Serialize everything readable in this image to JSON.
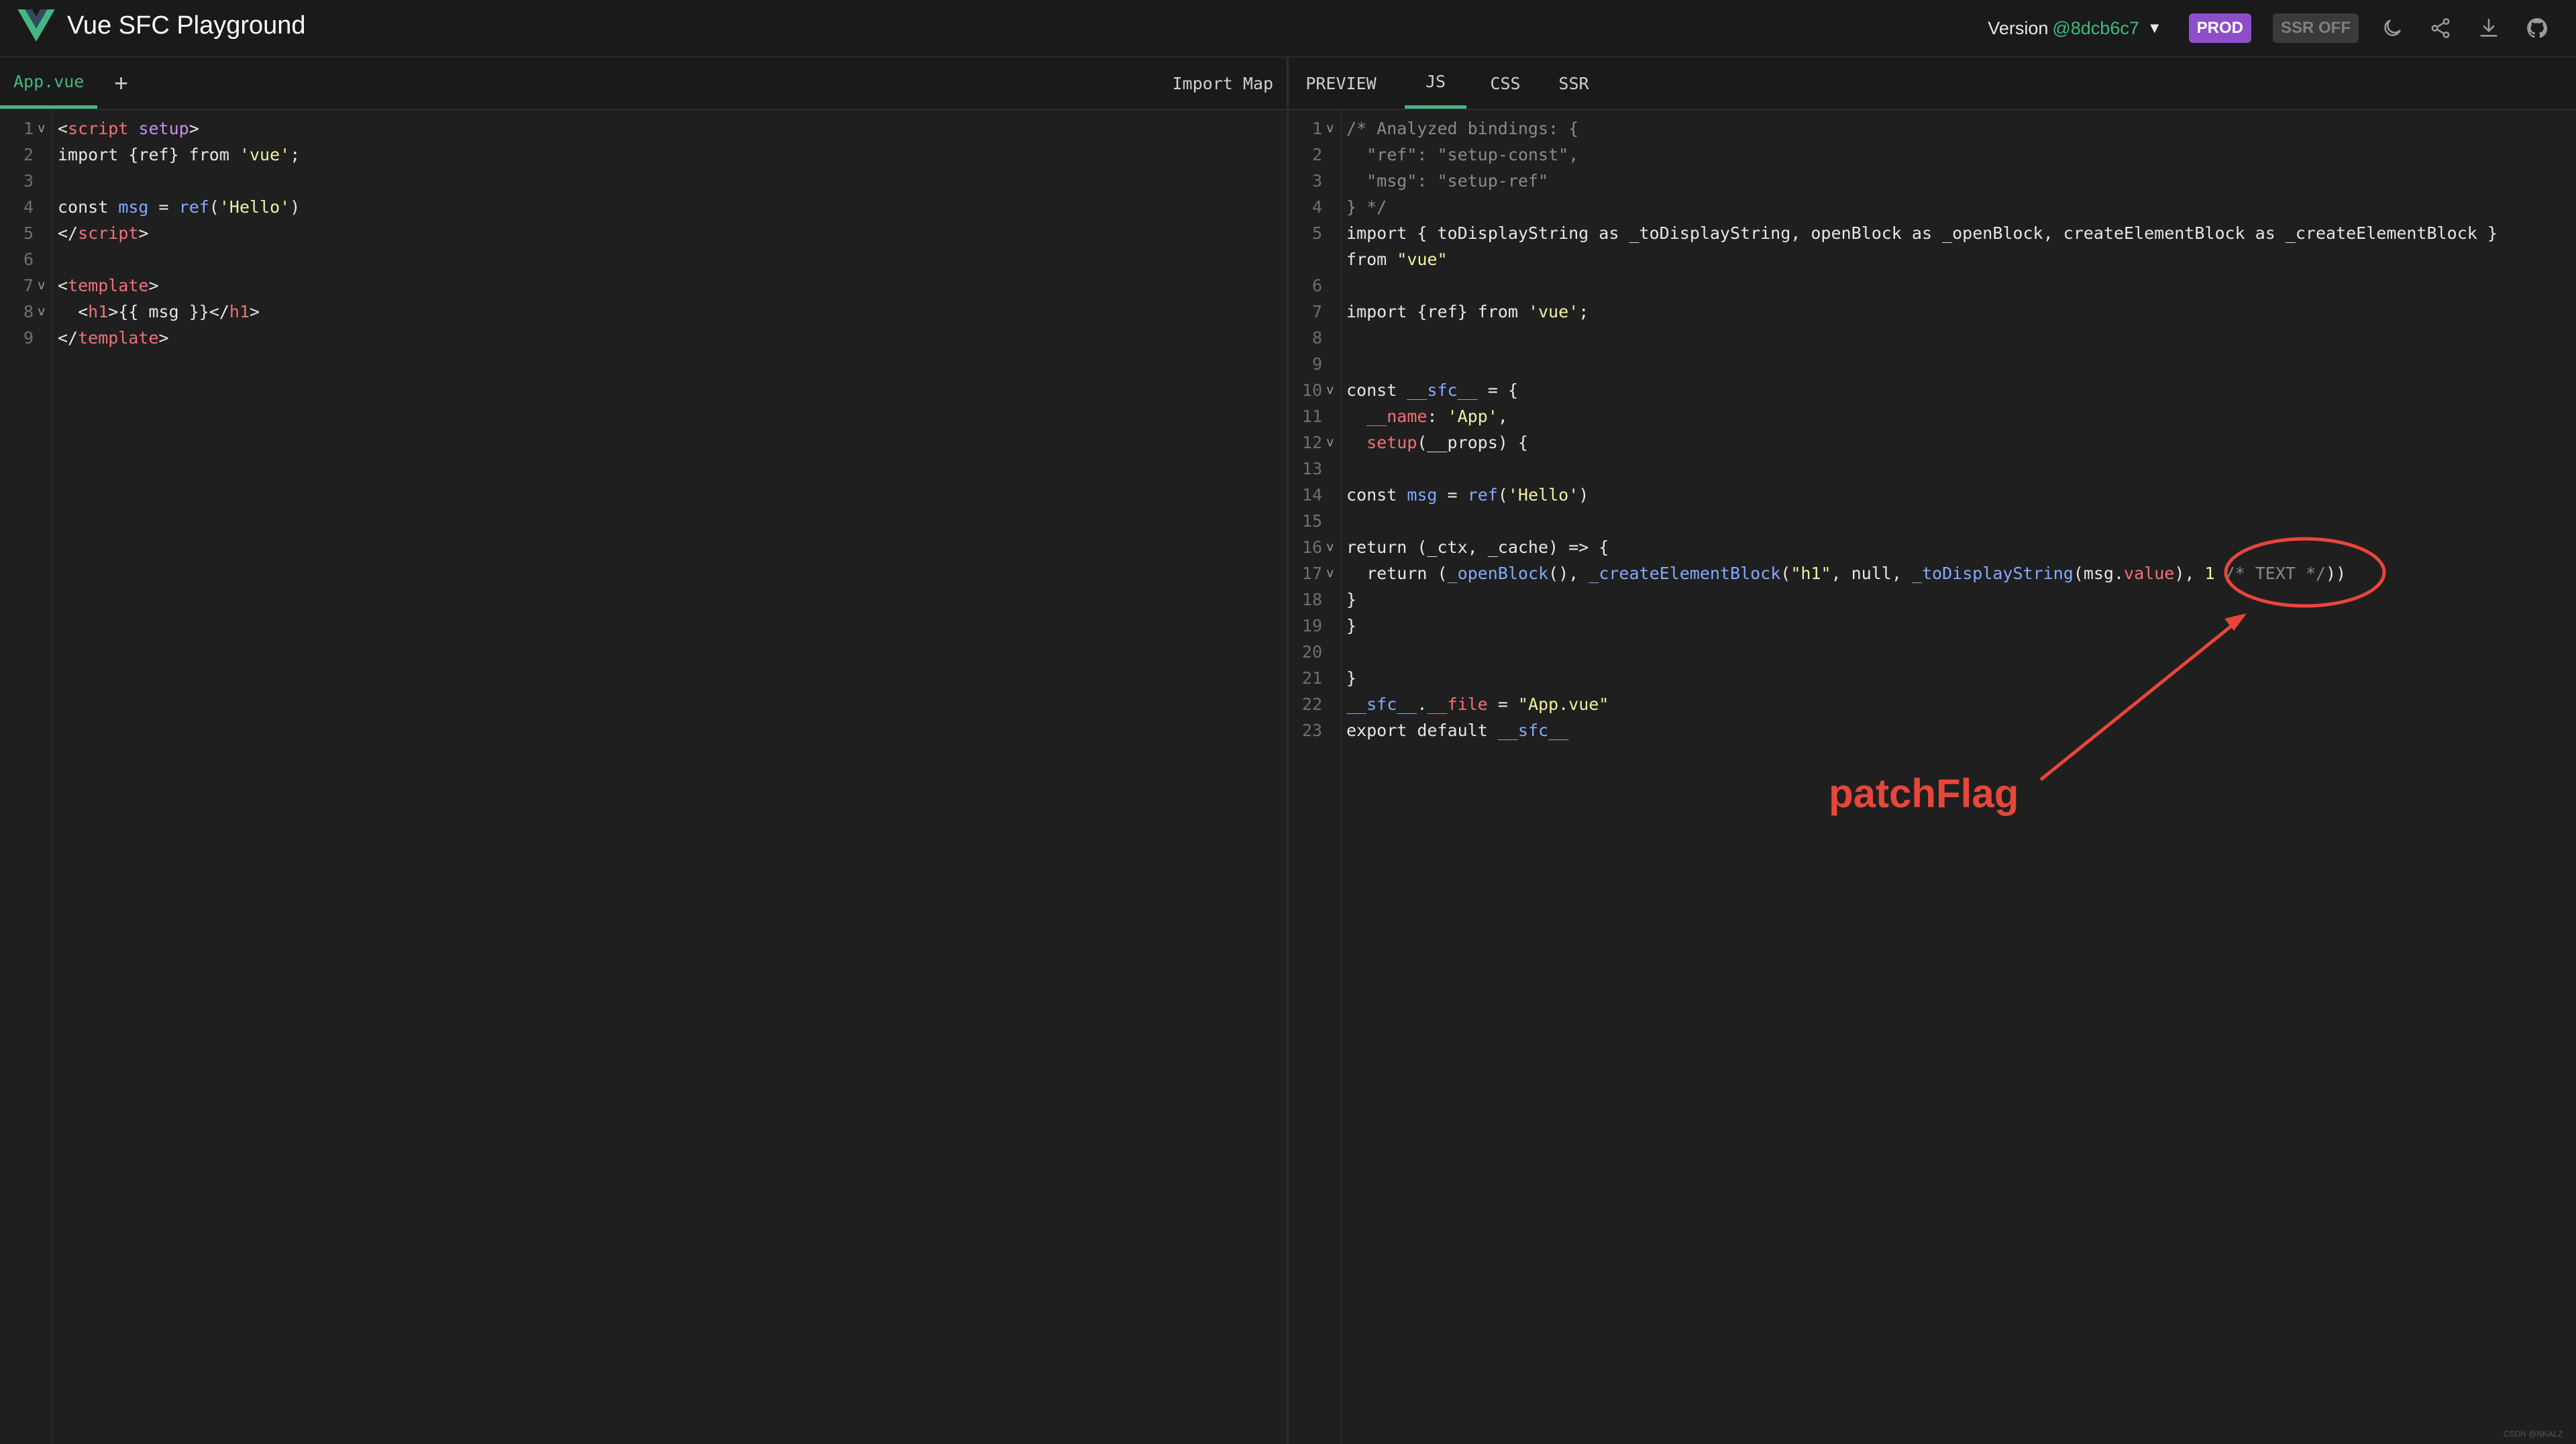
{
  "header": {
    "title": "Vue SFC Playground",
    "version_label": "Version",
    "version_value": "@8dcb6c7",
    "version_caret": "▼",
    "prod_badge": "PROD",
    "ssr_badge": "SSR OFF",
    "icons": [
      "moon-icon",
      "share-icon",
      "download-icon",
      "github-icon"
    ]
  },
  "left_panel": {
    "file_tab": "App.vue",
    "add_file": "+",
    "import_map": "Import Map",
    "lines": [
      {
        "n": "1",
        "fold": "v",
        "tokens": [
          [
            "t-punc",
            "<"
          ],
          [
            "t-tag",
            "script"
          ],
          [
            "t-txt",
            " "
          ],
          [
            "t-attr",
            "setup"
          ],
          [
            "t-punc",
            ">"
          ]
        ]
      },
      {
        "n": "2",
        "fold": "",
        "tokens": [
          [
            "t-kw",
            "import"
          ],
          [
            "t-txt",
            " {ref} "
          ],
          [
            "t-kw",
            "from"
          ],
          [
            "t-txt",
            " "
          ],
          [
            "t-str",
            "'vue'"
          ],
          [
            "t-txt",
            ";"
          ]
        ]
      },
      {
        "n": "3",
        "fold": "",
        "tokens": []
      },
      {
        "n": "4",
        "fold": "",
        "tokens": [
          [
            "t-kw",
            "const"
          ],
          [
            "t-txt",
            " "
          ],
          [
            "t-fn",
            "msg"
          ],
          [
            "t-txt",
            " = "
          ],
          [
            "t-fn",
            "ref"
          ],
          [
            "t-txt",
            "("
          ],
          [
            "t-str",
            "'Hello'"
          ],
          [
            "t-txt",
            ")"
          ]
        ]
      },
      {
        "n": "5",
        "fold": "",
        "tokens": [
          [
            "t-punc",
            "</"
          ],
          [
            "t-tag",
            "script"
          ],
          [
            "t-punc",
            ">"
          ]
        ]
      },
      {
        "n": "6",
        "fold": "",
        "tokens": []
      },
      {
        "n": "7",
        "fold": "v",
        "tokens": [
          [
            "t-punc",
            "<"
          ],
          [
            "t-tag",
            "template"
          ],
          [
            "t-punc",
            ">"
          ]
        ]
      },
      {
        "n": "8",
        "fold": "v",
        "tokens": [
          [
            "t-txt",
            "  "
          ],
          [
            "t-punc",
            "<"
          ],
          [
            "t-tag",
            "h1"
          ],
          [
            "t-punc",
            ">"
          ],
          [
            "t-txt",
            "{{ msg }}"
          ],
          [
            "t-punc",
            "</"
          ],
          [
            "t-tag",
            "h1"
          ],
          [
            "t-punc",
            ">"
          ]
        ]
      },
      {
        "n": "9",
        "fold": "",
        "tokens": [
          [
            "t-punc",
            "</"
          ],
          [
            "t-tag",
            "template"
          ],
          [
            "t-punc",
            ">"
          ]
        ]
      }
    ]
  },
  "right_panel": {
    "tabs": [
      {
        "label": "PREVIEW",
        "active": false
      },
      {
        "label": "JS",
        "active": true
      },
      {
        "label": "CSS",
        "active": false
      },
      {
        "label": "SSR",
        "active": false
      }
    ],
    "lines": [
      {
        "n": "1",
        "fold": "v",
        "tokens": [
          [
            "t-cmt",
            "/* Analyzed bindings: {"
          ]
        ]
      },
      {
        "n": "2",
        "fold": "",
        "tokens": [
          [
            "t-cmt",
            "  \"ref\": \"setup-const\","
          ]
        ]
      },
      {
        "n": "3",
        "fold": "",
        "tokens": [
          [
            "t-cmt",
            "  \"msg\": \"setup-ref\""
          ]
        ]
      },
      {
        "n": "4",
        "fold": "",
        "tokens": [
          [
            "t-cmt",
            "} */"
          ]
        ]
      },
      {
        "n": "5",
        "fold": "",
        "tokens": [
          [
            "t-kw",
            "import"
          ],
          [
            "t-txt",
            " { toDisplayString "
          ],
          [
            "t-kw",
            "as"
          ],
          [
            "t-txt",
            " _toDisplayString, openBlock "
          ],
          [
            "t-kw",
            "as"
          ],
          [
            "t-txt",
            " _openBlock, createElementBlock "
          ],
          [
            "t-kw",
            "as"
          ],
          [
            "t-txt",
            " _createElementBlock }"
          ]
        ]
      },
      {
        "n": "",
        "fold": "",
        "tokens": [
          [
            "t-kw",
            "from"
          ],
          [
            "t-txt",
            " "
          ],
          [
            "t-str",
            "\"vue\""
          ]
        ]
      },
      {
        "n": "6",
        "fold": "",
        "tokens": []
      },
      {
        "n": "7",
        "fold": "",
        "tokens": [
          [
            "t-kw",
            "import"
          ],
          [
            "t-txt",
            " {ref} "
          ],
          [
            "t-kw",
            "from"
          ],
          [
            "t-txt",
            " "
          ],
          [
            "t-str",
            "'vue'"
          ],
          [
            "t-txt",
            ";"
          ]
        ]
      },
      {
        "n": "8",
        "fold": "",
        "tokens": []
      },
      {
        "n": "9",
        "fold": "",
        "tokens": []
      },
      {
        "n": "10",
        "fold": "v",
        "tokens": [
          [
            "t-kw",
            "const"
          ],
          [
            "t-txt",
            " "
          ],
          [
            "t-fn",
            "__sfc__"
          ],
          [
            "t-txt",
            " = {"
          ]
        ]
      },
      {
        "n": "11",
        "fold": "",
        "tokens": [
          [
            "t-txt",
            "  "
          ],
          [
            "t-prop",
            "__name"
          ],
          [
            "t-txt",
            ": "
          ],
          [
            "t-str",
            "'App'"
          ],
          [
            "t-txt",
            ","
          ]
        ]
      },
      {
        "n": "12",
        "fold": "v",
        "tokens": [
          [
            "t-txt",
            "  "
          ],
          [
            "t-prop",
            "setup"
          ],
          [
            "t-txt",
            "(__props) {"
          ]
        ]
      },
      {
        "n": "13",
        "fold": "",
        "tokens": []
      },
      {
        "n": "14",
        "fold": "",
        "tokens": [
          [
            "t-kw",
            "const"
          ],
          [
            "t-txt",
            " "
          ],
          [
            "t-fn",
            "msg"
          ],
          [
            "t-txt",
            " = "
          ],
          [
            "t-fn",
            "ref"
          ],
          [
            "t-txt",
            "("
          ],
          [
            "t-str",
            "'Hello'"
          ],
          [
            "t-txt",
            ")"
          ]
        ]
      },
      {
        "n": "15",
        "fold": "",
        "tokens": []
      },
      {
        "n": "16",
        "fold": "v",
        "tokens": [
          [
            "t-kw",
            "return"
          ],
          [
            "t-txt",
            " (_ctx, _cache) => {"
          ]
        ]
      },
      {
        "n": "17",
        "fold": "v",
        "tokens": [
          [
            "t-txt",
            "  "
          ],
          [
            "t-kw",
            "return"
          ],
          [
            "t-txt",
            " ("
          ],
          [
            "t-fn",
            "_openBlock"
          ],
          [
            "t-txt",
            "(), "
          ],
          [
            "t-fn",
            "_createElementBlock"
          ],
          [
            "t-txt",
            "("
          ],
          [
            "t-str",
            "\"h1\""
          ],
          [
            "t-txt",
            ", null, "
          ],
          [
            "t-fn",
            "_toDisplayString"
          ],
          [
            "t-txt",
            "(msg."
          ],
          [
            "t-prop",
            "value"
          ],
          [
            "t-txt",
            "), "
          ],
          [
            "t-str",
            "1"
          ],
          [
            "t-txt",
            " "
          ],
          [
            "t-cmt",
            "/* TEXT */"
          ],
          [
            "t-txt",
            "))"
          ]
        ]
      },
      {
        "n": "18",
        "fold": "",
        "tokens": [
          [
            "t-txt",
            "}"
          ]
        ]
      },
      {
        "n": "19",
        "fold": "",
        "tokens": [
          [
            "t-txt",
            "}"
          ]
        ]
      },
      {
        "n": "20",
        "fold": "",
        "tokens": []
      },
      {
        "n": "21",
        "fold": "",
        "tokens": [
          [
            "t-txt",
            "}"
          ]
        ]
      },
      {
        "n": "22",
        "fold": "",
        "tokens": [
          [
            "t-fn",
            "__sfc__"
          ],
          [
            "t-txt",
            "."
          ],
          [
            "t-prop",
            "__file"
          ],
          [
            "t-txt",
            " = "
          ],
          [
            "t-str",
            "\"App.vue\""
          ]
        ]
      },
      {
        "n": "23",
        "fold": "",
        "tokens": [
          [
            "t-kw",
            "export"
          ],
          [
            "t-txt",
            " "
          ],
          [
            "t-kw",
            "default"
          ],
          [
            "t-txt",
            " "
          ],
          [
            "t-fn",
            "__sfc__"
          ]
        ]
      }
    ]
  },
  "annotation": {
    "label": "patchFlag",
    "color": "#e8463a"
  },
  "colors": {
    "accent": "#42b883",
    "prod_badge": "#8c4ec9",
    "background": "#1f1f1f"
  },
  "watermark": "CSDN @NKALZ"
}
